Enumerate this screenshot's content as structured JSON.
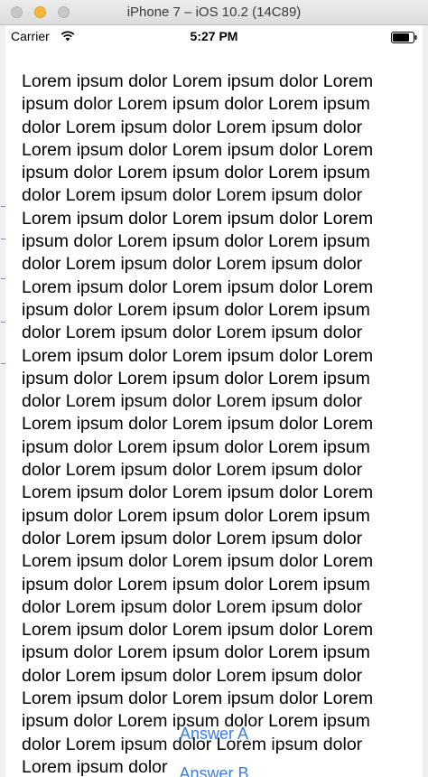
{
  "window": {
    "title": "iPhone 7 – iOS 10.2 (14C89)"
  },
  "status_bar": {
    "carrier": "Carrier",
    "time": "5:27 PM",
    "icons": [
      "wifi-icon",
      "battery-icon"
    ]
  },
  "content": {
    "body_text": "Lorem ipsum dolor Lorem ipsum dolor Lorem ipsum dolor Lorem ipsum dolor Lorem ipsum dolor Lorem ipsum dolor Lorem ipsum dolor Lorem ipsum dolor Lorem ipsum dolor Lorem ipsum dolor Lorem ipsum dolor Lorem ipsum dolor Lorem ipsum dolor Lorem ipsum dolor Lorem ipsum dolor Lorem ipsum dolor Lorem ipsum dolor Lorem ipsum dolor Lorem ipsum dolor Lorem ipsum dolor Lorem ipsum dolor Lorem ipsum dolor Lorem ipsum dolor Lorem ipsum dolor Lorem ipsum dolor Lorem ipsum dolor Lorem ipsum dolor Lorem ipsum dolor Lorem ipsum dolor Lorem ipsum dolor Lorem ipsum dolor Lorem ipsum dolor Lorem ipsum dolor Lorem ipsum dolor Lorem ipsum dolor Lorem ipsum dolor Lorem ipsum dolor Lorem ipsum dolor Lorem ipsum dolor Lorem ipsum dolor Lorem ipsum dolor Lorem ipsum dolor Lorem ipsum dolor Lorem ipsum dolor Lorem ipsum dolor Lorem ipsum dolor Lorem ipsum dolor Lorem ipsum dolor Lorem ipsum dolor Lorem ipsum dolor Lorem ipsum dolor Lorem ipsum dolor Lorem ipsum dolor Lorem ipsum dolor Lorem ipsum dolor Lorem ipsum dolor Lorem ipsum dolor Lorem ipsum dolor Lorem ipsum dolor Lorem ipsum dolor Lorem ipsum dolor Lorem ipsum dolor Lorem ipsum dolor Lorem ipsum dolor Lorem ipsum dolor Lorem ipsum dolor Lorem ipsum dolor Lorem ipsum dolor Lorem ipsum dolor Lorem ipsum dolor Lorem ipsum dolor"
  },
  "answers": {
    "a_label": "Answer A",
    "b_label": "Answer B"
  },
  "colors": {
    "accent": "#3a7ee0",
    "text": "#000000",
    "background": "#ffffff"
  }
}
